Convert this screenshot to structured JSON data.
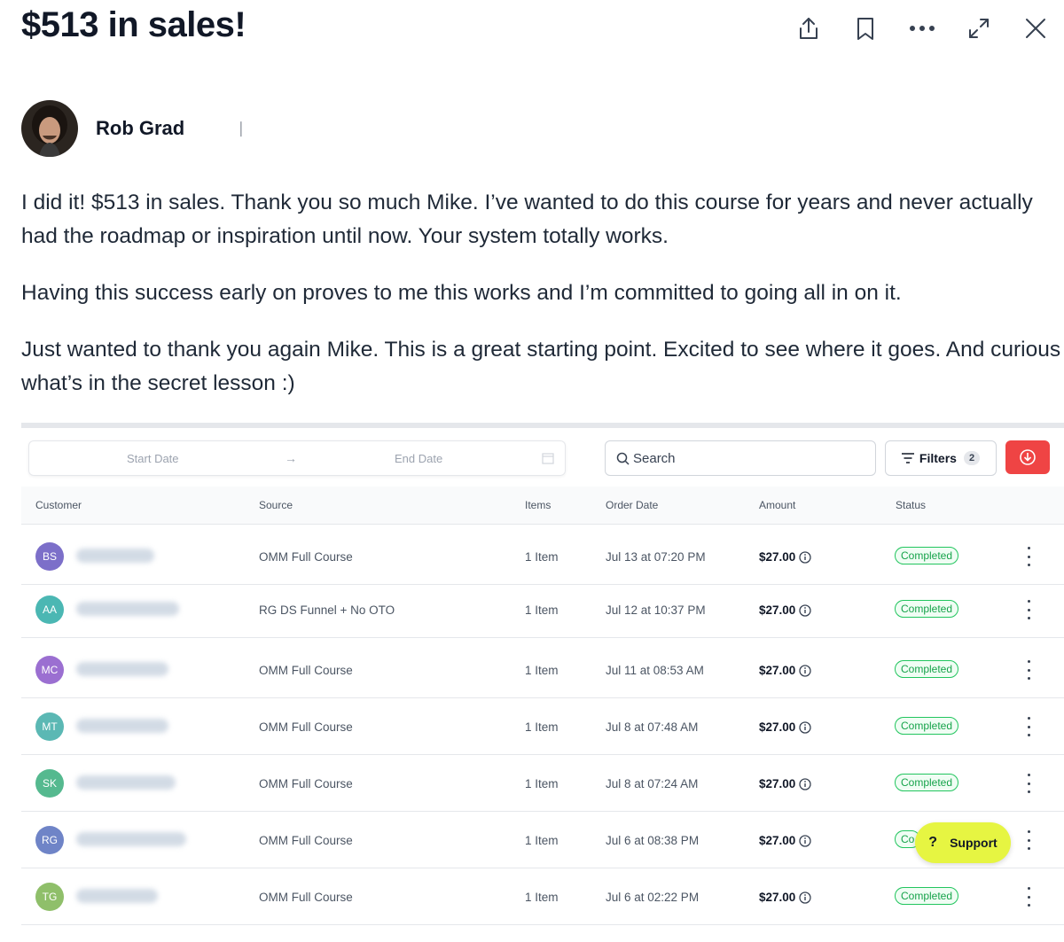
{
  "post": {
    "title": "$513 in sales!",
    "author": "Rob Grad",
    "paragraphs": [
      "I did it! $513 in sales. Thank you so much Mike. I’ve wanted to do this course for years and never actually had the roadmap or inspiration until now. Your system totally works.",
      "Having this success early on proves to me this works and I’m committed to going all in on it.",
      "Just wanted to thank you again Mike. This is a great starting point. Excited to see where it goes. And curious what’s in the secret lesson :)"
    ]
  },
  "toolbar": {
    "icons": [
      "share-icon",
      "bookmark-icon",
      "more-icon",
      "expand-icon",
      "close-icon"
    ]
  },
  "orders": {
    "start_date_placeholder": "Start Date",
    "end_date_placeholder": "End Date",
    "search_placeholder": "Search",
    "filters_label": "Filters",
    "filters_count": "2",
    "columns": [
      "Customer",
      "Source",
      "Items",
      "Order Date",
      "Amount",
      "Status"
    ],
    "rows": [
      {
        "initials": "BS",
        "avatar_color": "#7c6fc9",
        "source": "OMM Full Course",
        "items": "1 Item",
        "date": "Jul 13 at 07:20 PM",
        "amount": "$27.00",
        "status": "Completed"
      },
      {
        "initials": "AA",
        "avatar_color": "#4bb7b3",
        "source": "RG DS Funnel + No OTO",
        "items": "1 Item",
        "date": "Jul 12 at 10:37 PM",
        "amount": "$27.00",
        "status": "Completed"
      },
      {
        "initials": "MC",
        "avatar_color": "#9b6fd1",
        "source": "OMM Full Course",
        "items": "1 Item",
        "date": "Jul 11 at 08:53 AM",
        "amount": "$27.00",
        "status": "Completed"
      },
      {
        "initials": "MT",
        "avatar_color": "#5bb8b4",
        "source": "OMM Full Course",
        "items": "1 Item",
        "date": "Jul 8 at 07:48 AM",
        "amount": "$27.00",
        "status": "Completed"
      },
      {
        "initials": "SK",
        "avatar_color": "#55b98f",
        "source": "OMM Full Course",
        "items": "1 Item",
        "date": "Jul 8 at 07:24 AM",
        "amount": "$27.00",
        "status": "Completed"
      },
      {
        "initials": "RG",
        "avatar_color": "#6f84c7",
        "source": "OMM Full Course",
        "items": "1 Item",
        "date": "Jul 6 at 08:38 PM",
        "amount": "$27.00",
        "status": "Co"
      },
      {
        "initials": "TG",
        "avatar_color": "#8fbf6a",
        "source": "OMM Full Course",
        "items": "1 Item",
        "date": "Jul 6 at 02:22 PM",
        "amount": "$27.00",
        "status": "Completed"
      }
    ],
    "support_label": "Support"
  }
}
